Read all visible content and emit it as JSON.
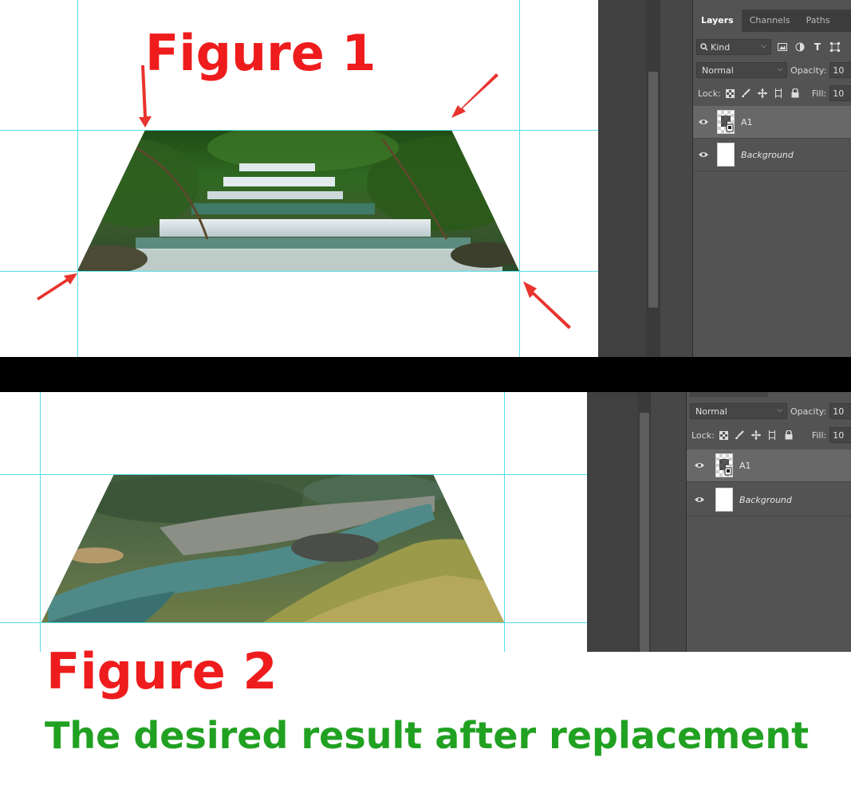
{
  "figure1": {
    "title": "Figure 1",
    "panel": {
      "tabs": [
        "Layers",
        "Channels",
        "Paths"
      ],
      "filter_kind": "Kind",
      "blend_mode": "Normal",
      "opacity_label": "Opacity:",
      "opacity_value": "10",
      "lock_label": "Lock:",
      "fill_label": "Fill:",
      "fill_value": "10",
      "layers": [
        {
          "name": "A1",
          "selected": true
        },
        {
          "name": "Background",
          "selected": false
        }
      ]
    }
  },
  "figure2": {
    "title": "Figure 2",
    "caption": "The desired result after replacement",
    "panel": {
      "blend_mode": "Normal",
      "opacity_label": "Opacity:",
      "opacity_value": "10",
      "lock_label": "Lock:",
      "fill_label": "Fill:",
      "fill_value": "10",
      "layers": [
        {
          "name": "A1",
          "selected": true
        },
        {
          "name": "Background",
          "selected": false
        }
      ]
    }
  },
  "colors": {
    "guide": "#56dde6",
    "arrow": "#e8332e",
    "figure_title": "#ee1c1c",
    "caption": "#21a121",
    "panel_bg": "#535353"
  },
  "icons": [
    "eye-icon",
    "search-icon",
    "lock-transparent-icon",
    "lock-brush-icon",
    "lock-move-icon",
    "lock-artboard-icon",
    "lock-all-icon",
    "layer-thumbnail"
  ]
}
